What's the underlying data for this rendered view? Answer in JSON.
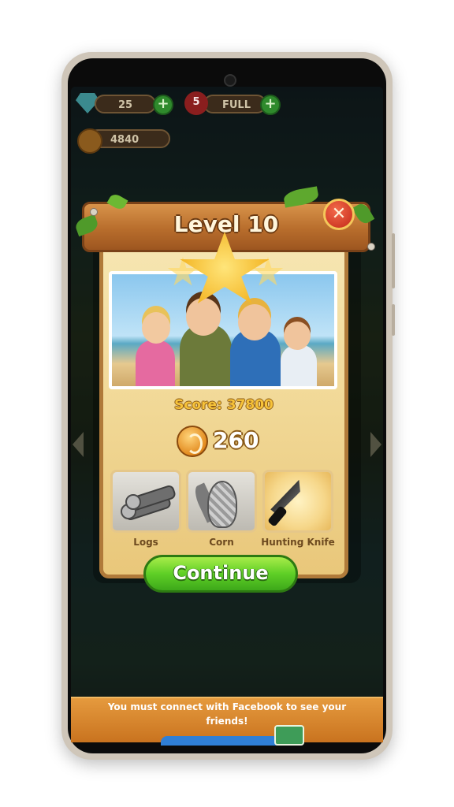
{
  "hud": {
    "gems": "25",
    "lives": "5",
    "lives_status": "FULL",
    "coins": "4840",
    "plus_symbol": "+"
  },
  "dialog": {
    "title": "Level 10",
    "close_symbol": "✕",
    "score": "Score: 37800",
    "coin_reward": "260",
    "items": [
      {
        "label": "Logs",
        "icon": "logs-icon",
        "state": "grey"
      },
      {
        "label": "Corn",
        "icon": "corn-icon",
        "state": "grey"
      },
      {
        "label": "Hunting Knife",
        "icon": "hunting-knife-icon",
        "state": "gold"
      }
    ],
    "continue_label": "Continue"
  },
  "banner": {
    "message": "You must connect with Facebook to see your friends!"
  },
  "colors": {
    "plank": "#b86d2c",
    "panel": "#f1d896",
    "continue_green": "#5fcf26",
    "close_red": "#c22818",
    "banner_orange": "#e59a3e"
  }
}
